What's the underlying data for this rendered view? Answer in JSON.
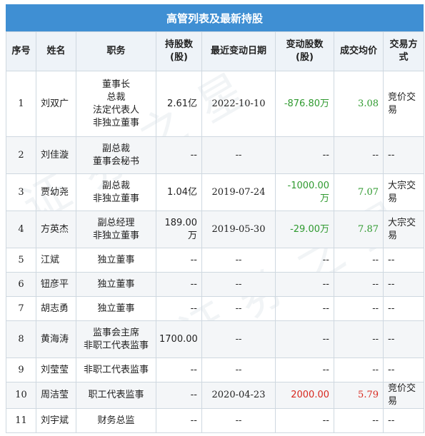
{
  "title": "高管列表及最新持股",
  "watermark": "证券之星",
  "headers": {
    "seq": "序号",
    "name": "姓名",
    "position": "职务",
    "holding_l1": "持股数",
    "holding_l2": "(股)",
    "date": "最近变动日期",
    "change_l1": "变动股数",
    "change_l2": "(股)",
    "price": "成交均价",
    "method": "交易方式"
  },
  "rows": [
    {
      "seq": "1",
      "name": "刘双广",
      "positions": [
        "董事长",
        "总裁",
        "法定代表人",
        "非独立董事"
      ],
      "holding": "2.61亿",
      "date": "2022-10-10",
      "change": "-876.80万",
      "change_color": "green",
      "price": "3.08",
      "price_color": "green",
      "method": "竞价交易"
    },
    {
      "seq": "2",
      "name": "刘佳漩",
      "positions": [
        "副总裁",
        "董事会秘书"
      ],
      "holding": "--",
      "date": "--",
      "change": "--",
      "change_color": "",
      "price": "--",
      "price_color": "",
      "method": "--"
    },
    {
      "seq": "3",
      "name": "贾幼尧",
      "positions": [
        "副总裁",
        "非独立董事"
      ],
      "holding": "1.04亿",
      "date": "2019-07-24",
      "change": "-1000.00万",
      "change_color": "green",
      "price": "7.07",
      "price_color": "green",
      "method": "大宗交易"
    },
    {
      "seq": "4",
      "name": "方英杰",
      "positions": [
        "副总经理",
        "非独立董事"
      ],
      "holding": "189.00万",
      "date": "2019-05-30",
      "change": "-29.00万",
      "change_color": "green",
      "price": "7.87",
      "price_color": "green",
      "method": "大宗交易"
    },
    {
      "seq": "5",
      "name": "江斌",
      "positions": [
        "独立董事"
      ],
      "holding": "--",
      "date": "--",
      "change": "--",
      "change_color": "",
      "price": "--",
      "price_color": "",
      "method": "--"
    },
    {
      "seq": "6",
      "name": "钮彦平",
      "positions": [
        "独立董事"
      ],
      "holding": "--",
      "date": "--",
      "change": "--",
      "change_color": "",
      "price": "--",
      "price_color": "",
      "method": "--"
    },
    {
      "seq": "7",
      "name": "胡志勇",
      "positions": [
        "独立董事"
      ],
      "holding": "--",
      "date": "--",
      "change": "--",
      "change_color": "",
      "price": "--",
      "price_color": "",
      "method": "--"
    },
    {
      "seq": "8",
      "name": "黄海涛",
      "positions": [
        "监事会主席",
        "非职工代表监事"
      ],
      "holding": "1700.00",
      "date": "--",
      "change": "--",
      "change_color": "",
      "price": "--",
      "price_color": "",
      "method": "--"
    },
    {
      "seq": "9",
      "name": "刘莹莹",
      "positions": [
        "非职工代表监事"
      ],
      "holding": "--",
      "date": "--",
      "change": "--",
      "change_color": "",
      "price": "--",
      "price_color": "",
      "method": "--"
    },
    {
      "seq": "10",
      "name": "周洁莹",
      "positions": [
        "职工代表监事"
      ],
      "holding": "--",
      "date": "2020-04-23",
      "change": "2000.00",
      "change_color": "red",
      "price": "5.79",
      "price_color": "red",
      "method": "竞价交易"
    },
    {
      "seq": "11",
      "name": "刘宇斌",
      "positions": [
        "财务总监"
      ],
      "holding": "--",
      "date": "--",
      "change": "--",
      "change_color": "",
      "price": "--",
      "price_color": "",
      "method": "--"
    }
  ]
}
